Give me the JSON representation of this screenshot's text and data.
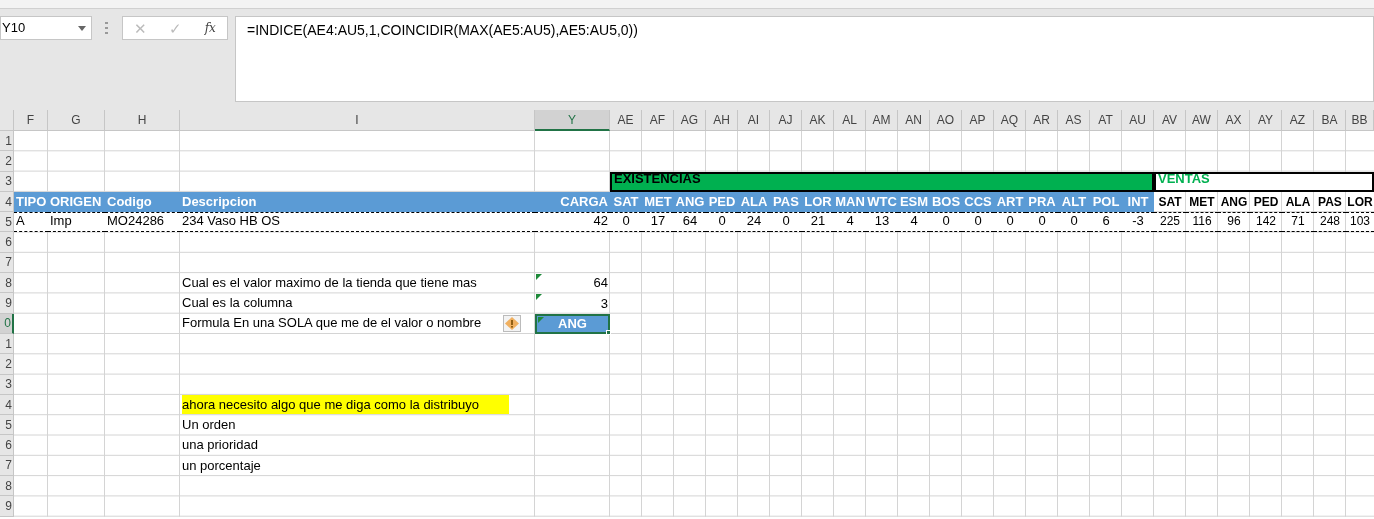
{
  "formula_bar": {
    "name_box": "Y10",
    "cancel_icon": "✕",
    "enter_icon": "✓",
    "function_label": "fx",
    "formula": "=INDICE(AE4:AU5,1,COINCIDIR(MAX(AE5:AU5),AE5:AU5,0))"
  },
  "columns": [
    {
      "label": "F",
      "selected": false
    },
    {
      "label": "G",
      "selected": false
    },
    {
      "label": "H",
      "selected": false
    },
    {
      "label": "I",
      "selected": false
    },
    {
      "label": "Y",
      "selected": true
    },
    {
      "label": "AE",
      "selected": false
    },
    {
      "label": "AF",
      "selected": false
    },
    {
      "label": "AG",
      "selected": false
    },
    {
      "label": "AH",
      "selected": false
    },
    {
      "label": "AI",
      "selected": false
    },
    {
      "label": "AJ",
      "selected": false
    },
    {
      "label": "AK",
      "selected": false
    },
    {
      "label": "AL",
      "selected": false
    },
    {
      "label": "AM",
      "selected": false
    },
    {
      "label": "AN",
      "selected": false
    },
    {
      "label": "AO",
      "selected": false
    },
    {
      "label": "AP",
      "selected": false
    },
    {
      "label": "AQ",
      "selected": false
    },
    {
      "label": "AR",
      "selected": false
    },
    {
      "label": "AS",
      "selected": false
    },
    {
      "label": "AT",
      "selected": false
    },
    {
      "label": "AU",
      "selected": false
    },
    {
      "label": "AV",
      "selected": false
    },
    {
      "label": "AW",
      "selected": false
    },
    {
      "label": "AX",
      "selected": false
    },
    {
      "label": "AY",
      "selected": false
    },
    {
      "label": "AZ",
      "selected": false
    },
    {
      "label": "BA",
      "selected": false
    },
    {
      "label": "BB",
      "selected": false
    }
  ],
  "rows": [
    {
      "number": "1",
      "selected": false,
      "kind": "empty"
    },
    {
      "number": "2",
      "selected": false,
      "kind": "empty"
    },
    {
      "number": "3",
      "selected": false,
      "kind": "band",
      "sections": [
        {
          "label": "EXISTENCIAS",
          "kind": "filled"
        },
        {
          "label": "VENTAS",
          "kind": "outlined"
        }
      ]
    },
    {
      "number": "4",
      "selected": false,
      "kind": "header",
      "tipo": "TIPO",
      "origen": "ORIGEN",
      "codigo": "Codigo",
      "descripcion": "Descripcion",
      "carga": "CARGA",
      "existencias": [
        "SAT",
        "MET",
        "ANG",
        "PED",
        "ALA",
        "PAS",
        "LOR",
        "MAN",
        "WTC",
        "ESM",
        "BOS",
        "CCS",
        "ART",
        "PRA",
        "ALT",
        "POL",
        "INT"
      ],
      "ventas": [
        "SAT",
        "MET",
        "ANG",
        "PED",
        "ALA",
        "PAS",
        "LOR"
      ]
    },
    {
      "number": "5",
      "selected": false,
      "kind": "record",
      "tipo": "A",
      "origen": "Imp",
      "codigo": "MO24286",
      "descripcion": "234 Vaso HB OS",
      "carga": "42",
      "existencias": [
        "0",
        "17",
        "64",
        "0",
        "24",
        "0",
        "21",
        "4",
        "13",
        "4",
        "0",
        "0",
        "0",
        "0",
        "0",
        "6",
        "-3"
      ],
      "ventas": [
        "225",
        "116",
        "96",
        "142",
        "71",
        "248",
        "103"
      ]
    },
    {
      "number": "6",
      "selected": false,
      "kind": "empty"
    },
    {
      "number": "7",
      "selected": false,
      "kind": "empty"
    },
    {
      "number": "8",
      "selected": false,
      "kind": "question",
      "text": "Cual es el valor maximo de la tienda que tiene mas",
      "answer": "64",
      "flagged": true,
      "warning": false,
      "result": false
    },
    {
      "number": "9",
      "selected": false,
      "kind": "question",
      "text": "Cual es la columna",
      "answer": "3",
      "flagged": true,
      "warning": false,
      "result": false
    },
    {
      "number": "0",
      "selected": true,
      "kind": "question",
      "text": "Formula En una SOLA  que me de el valor o nombre",
      "answer": "ANG",
      "flagged": true,
      "warning": true,
      "result": true
    },
    {
      "number": "1",
      "selected": false,
      "kind": "empty"
    },
    {
      "number": "2",
      "selected": false,
      "kind": "empty"
    },
    {
      "number": "3",
      "selected": false,
      "kind": "empty"
    },
    {
      "number": "4",
      "selected": false,
      "kind": "note",
      "text": "ahora necesito algo que me diga como la distribuyo",
      "highlighted": true
    },
    {
      "number": "5",
      "selected": false,
      "kind": "note",
      "text": "Un orden",
      "highlighted": false
    },
    {
      "number": "6",
      "selected": false,
      "kind": "note",
      "text": "una prioridad",
      "highlighted": false
    },
    {
      "number": "7",
      "selected": false,
      "kind": "note",
      "text": "un porcentaje",
      "highlighted": false
    },
    {
      "number": "8",
      "selected": false,
      "kind": "empty"
    },
    {
      "number": "9",
      "selected": false,
      "kind": "empty"
    }
  ]
}
